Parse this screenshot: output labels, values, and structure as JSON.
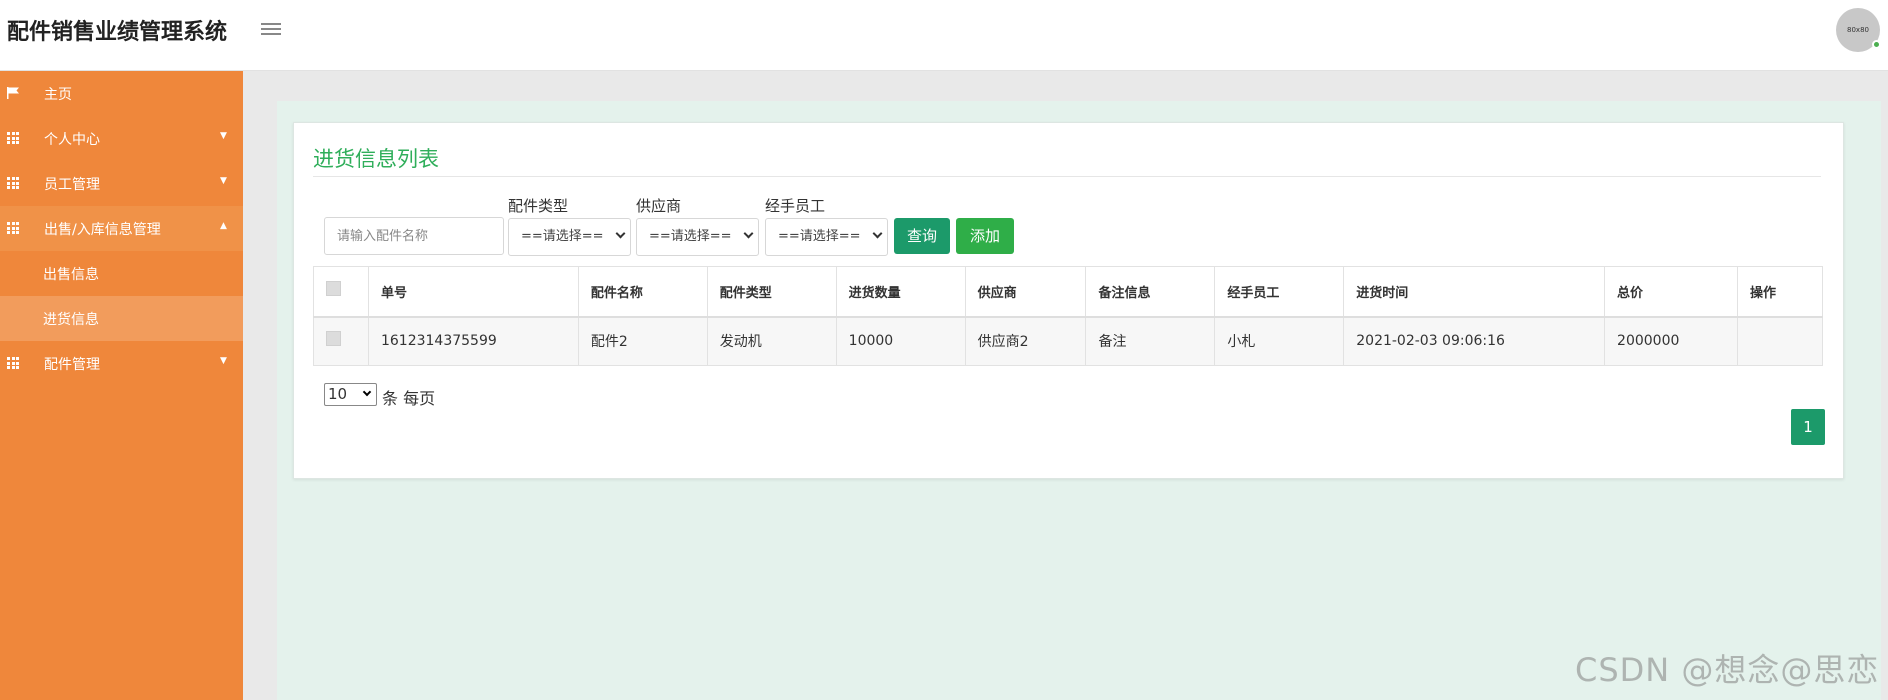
{
  "app": {
    "title": "配件销售业绩管理系统",
    "avatar_text": "80x80"
  },
  "sidebar": {
    "items": [
      {
        "label": "主页",
        "icon": "flag-icon"
      },
      {
        "label": "个人中心",
        "icon": "grid-icon"
      },
      {
        "label": "员工管理",
        "icon": "grid-icon"
      },
      {
        "label": "出售/入库信息管理",
        "icon": "grid-icon"
      },
      {
        "label": "出售信息"
      },
      {
        "label": "进货信息"
      },
      {
        "label": "配件管理",
        "icon": "grid-icon"
      }
    ]
  },
  "main": {
    "title": "进货信息列表",
    "filters": {
      "search_placeholder": "请输入配件名称",
      "type_label": "配件类型",
      "supplier_label": "供应商",
      "staff_label": "经手员工",
      "select_default": "==请选择=="
    },
    "buttons": {
      "search": "查询",
      "add": "添加"
    },
    "table": {
      "headers": [
        "单号",
        "配件名称",
        "配件类型",
        "进货数量",
        "供应商",
        "备注信息",
        "经手员工",
        "进货时间",
        "总价",
        "操作"
      ],
      "rows": [
        [
          "1612314375599",
          "配件2",
          "发动机",
          "10000",
          "供应商2",
          "备注",
          "小札",
          "2021-02-03 09:06:16",
          "2000000",
          ""
        ]
      ]
    },
    "pagination": {
      "page_size": "10",
      "page_size_label": "条 每页",
      "current_page": "1"
    }
  },
  "watermark": "CSDN @想念@思恋",
  "colors": {
    "sidebar": "#ef873b",
    "accent_green": "#2fae5a",
    "button_search": "#1c9a6a",
    "button_add": "#2fae48"
  }
}
